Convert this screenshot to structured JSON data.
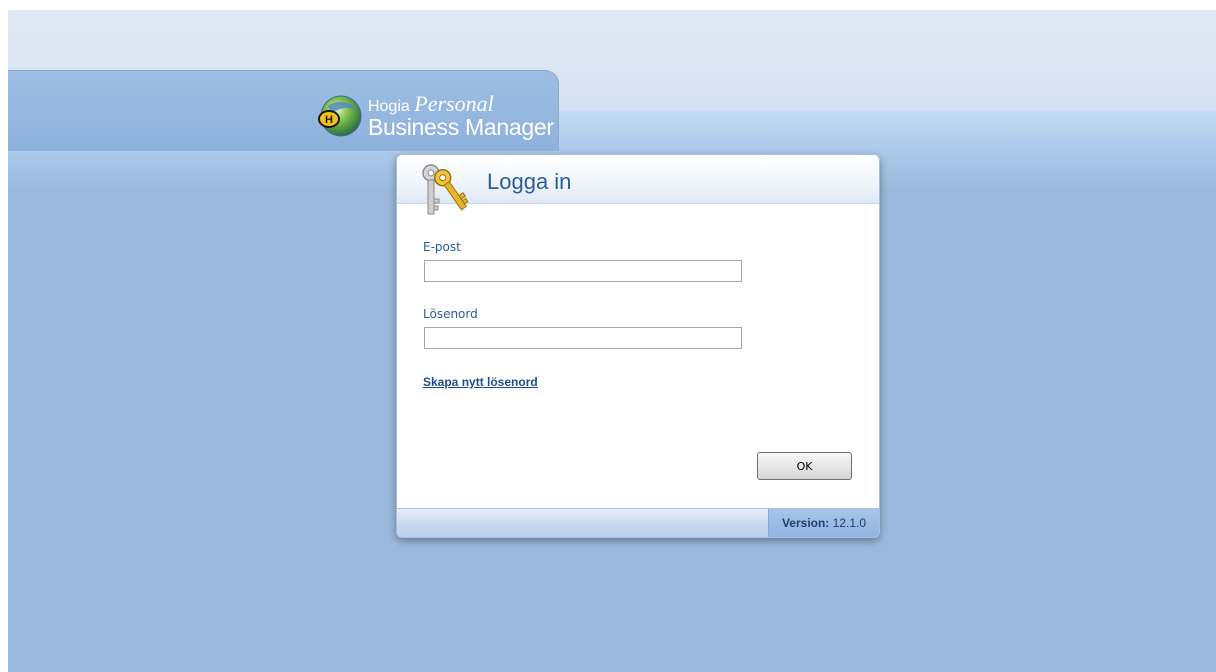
{
  "app": {
    "brand_top": "Hogia",
    "brand_script": "Personal",
    "brand_bottom": "Business Manager"
  },
  "login": {
    "title": "Logga in",
    "email_label": "E-post",
    "email_value": "",
    "password_label": "Lösenord",
    "password_value": "",
    "create_password_link": "Skapa nytt lösenord",
    "ok_label": "OK"
  },
  "status": {
    "version_label": "Version:",
    "version_value": "12.1.0"
  },
  "icons": {
    "logo": "hogia-globe-icon",
    "dialog": "keys-icon"
  },
  "colors": {
    "background": "#9ab9dc",
    "accent_text": "#2a5c9c",
    "link": "#1f4e8c"
  }
}
